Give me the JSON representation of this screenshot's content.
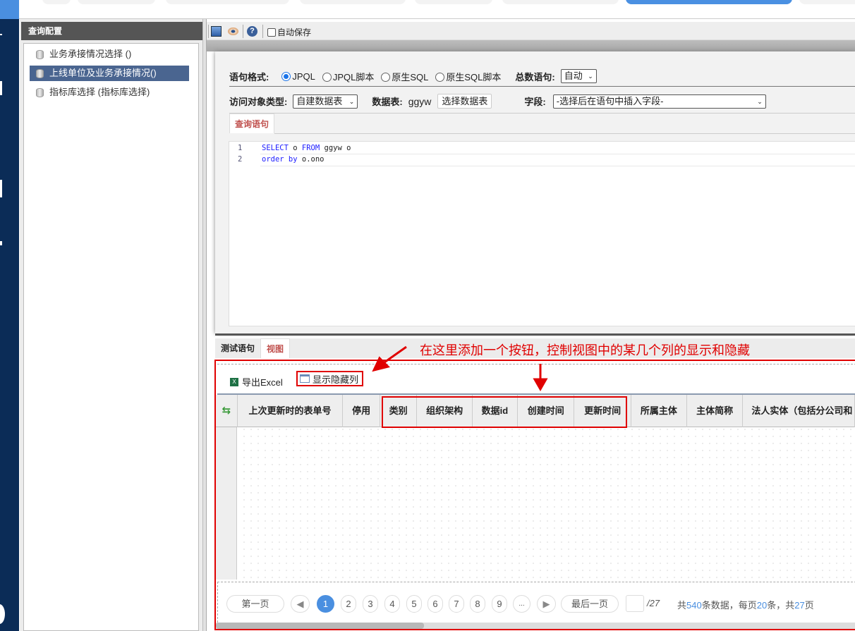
{
  "left_panel": {
    "title": "查询配置",
    "items": [
      {
        "label": "业务承接情况选择 ()"
      },
      {
        "label": "上线单位及业务承接情况()"
      },
      {
        "label": "指标库选择 (指标库选择)"
      }
    ]
  },
  "toolbar": {
    "autosave_label": "自动保存"
  },
  "query": {
    "format_label": "语句格式:",
    "format_options": [
      "JPQL",
      "JPQL脚本",
      "原生SQL",
      "原生SQL脚本"
    ],
    "count_label": "总数语句:",
    "count_value": "自动",
    "object_type_label": "访问对象类型:",
    "object_type_value": "自建数据表",
    "table_label": "数据表:",
    "table_value": "ggyw",
    "choose_table_button": "选择数据表",
    "field_label": "字段:",
    "field_value": "-选择后在语句中插入字段-",
    "tab_label": "查询语句",
    "code": {
      "line1_no": "1",
      "line1_kw1": "SELECT",
      "line1_a": " o ",
      "line1_kw2": "FROM",
      "line1_b": " ggyw o",
      "line2_no": "2",
      "line2_kw": "order by",
      "line2_a": " o.ono"
    }
  },
  "bottom_tabs": [
    "测试语句",
    "视图"
  ],
  "view": {
    "export_button": "导出Excel",
    "toggle_columns_button": "显示隐藏列",
    "columns": [
      "上次更新时的表单号",
      "停用",
      "类别",
      "组织架构",
      "数据id",
      "创建时间",
      "更新时间",
      "所属主体",
      "主体简称",
      "法人实体（包括分公司和"
    ]
  },
  "pager": {
    "first": "第一页",
    "pages": [
      "1",
      "2",
      "3",
      "4",
      "5",
      "6",
      "7",
      "8",
      "9",
      "..."
    ],
    "current_page": 1,
    "last": "最后一页",
    "total_pages_label": "/27",
    "summary_prefix": "共",
    "total_records": "540",
    "summary_mid1": "条数据，每页",
    "page_size": "20",
    "summary_mid2": "条，共",
    "total_pages": "27",
    "summary_suffix": "页"
  },
  "annotation": {
    "text": "在这里添加一个按钮，控制视图中的某几个列的显示和隐藏",
    "color": "#e00000"
  }
}
